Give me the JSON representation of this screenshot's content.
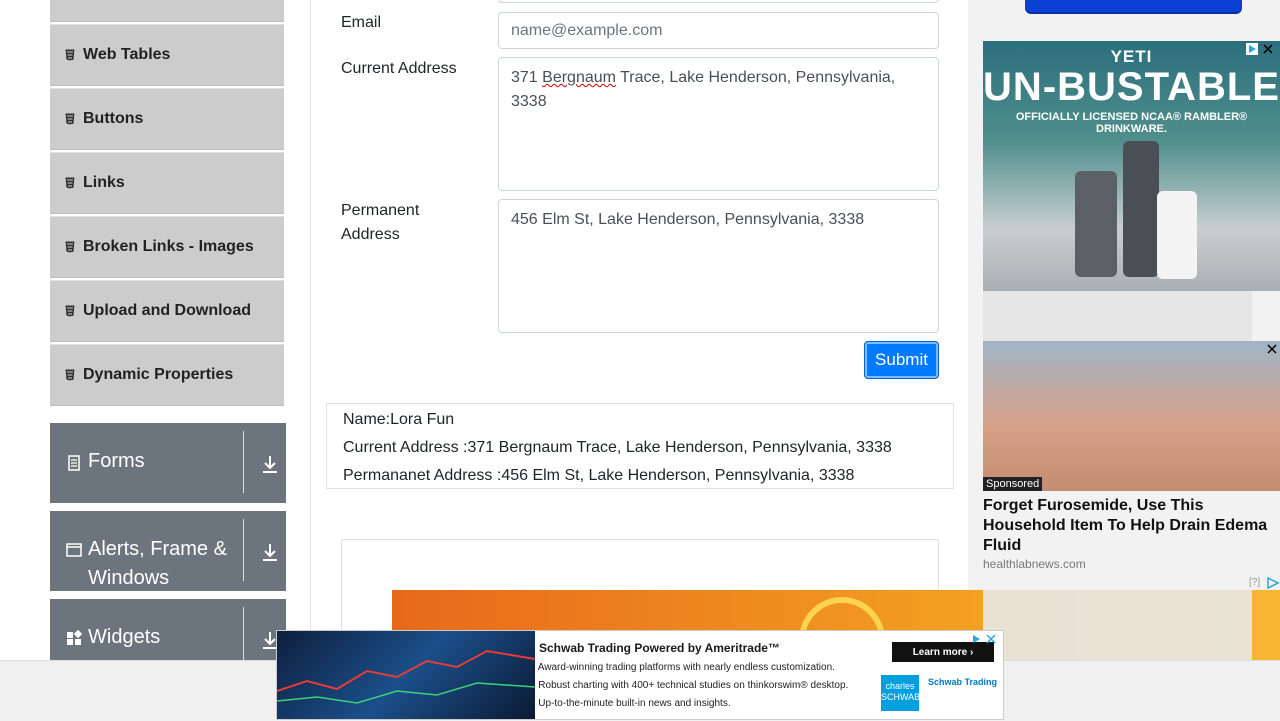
{
  "sidebar": {
    "items": [
      {
        "label": "Web Tables"
      },
      {
        "label": "Buttons"
      },
      {
        "label": "Links"
      },
      {
        "label": "Broken Links - Images"
      },
      {
        "label": "Upload and Download"
      },
      {
        "label": "Dynamic Properties"
      }
    ],
    "groups": [
      {
        "label": "Forms",
        "icon": "form-icon"
      },
      {
        "label": "Alerts, Frame & Windows",
        "icon": "window-icon"
      },
      {
        "label": "Widgets",
        "icon": "widgets-icon"
      }
    ]
  },
  "form": {
    "email_label": "Email",
    "email_placeholder": "name@example.com",
    "current_address_label": "Current Address",
    "current_address_value_part1": "371 ",
    "current_address_value_misspelled": "Bergnaum",
    "current_address_value_part2": " Trace, Lake Henderson, Pennsylvania, 3338",
    "permanent_address_label": "Permanent Address",
    "permanent_address_value": "456 Elm St, Lake Henderson, Pennsylvania, 3338",
    "submit_label": "Submit"
  },
  "output": {
    "name": "Name:Lora Fun",
    "current_address": "Current Address :371 Bergnaum Trace, Lake Henderson, Pennsylvania, 3338",
    "permanent_address": "Permananet Address :456 Elm St, Lake Henderson, Pennsylvania, 3338"
  },
  "ads": {
    "yeti_brand": "YETI",
    "yeti_headline": "UN-BUSTABLE",
    "yeti_sub": "OFFICIALLY LICENSED NCAA® RAMBLER® DRINKWARE.",
    "sponsored": "Sponsored",
    "feet_headline": "Forget Furosemide, Use This Household Item To Help Drain Edema Fluid",
    "feet_source": "healthlabnews.com",
    "feet_help": "[?]",
    "schwab_title": "Schwab Trading Powered by Ameritrade™",
    "schwab_b1": "• Award-winning trading platforms with nearly endless customization.",
    "schwab_b2": "• Robust charting with 400+ technical studies on thinkorswim® desktop.",
    "schwab_b3": "• Up-to-the-minute built-in news and insights.",
    "schwab_cta": "Learn more ›",
    "schwab_logo1": "charles SCHWAB",
    "schwab_logo2": "Schwab Trading"
  },
  "colors": {
    "primary": "#007bff",
    "sidebar_group": "#6c757d",
    "menu_item": "#cccccc"
  }
}
